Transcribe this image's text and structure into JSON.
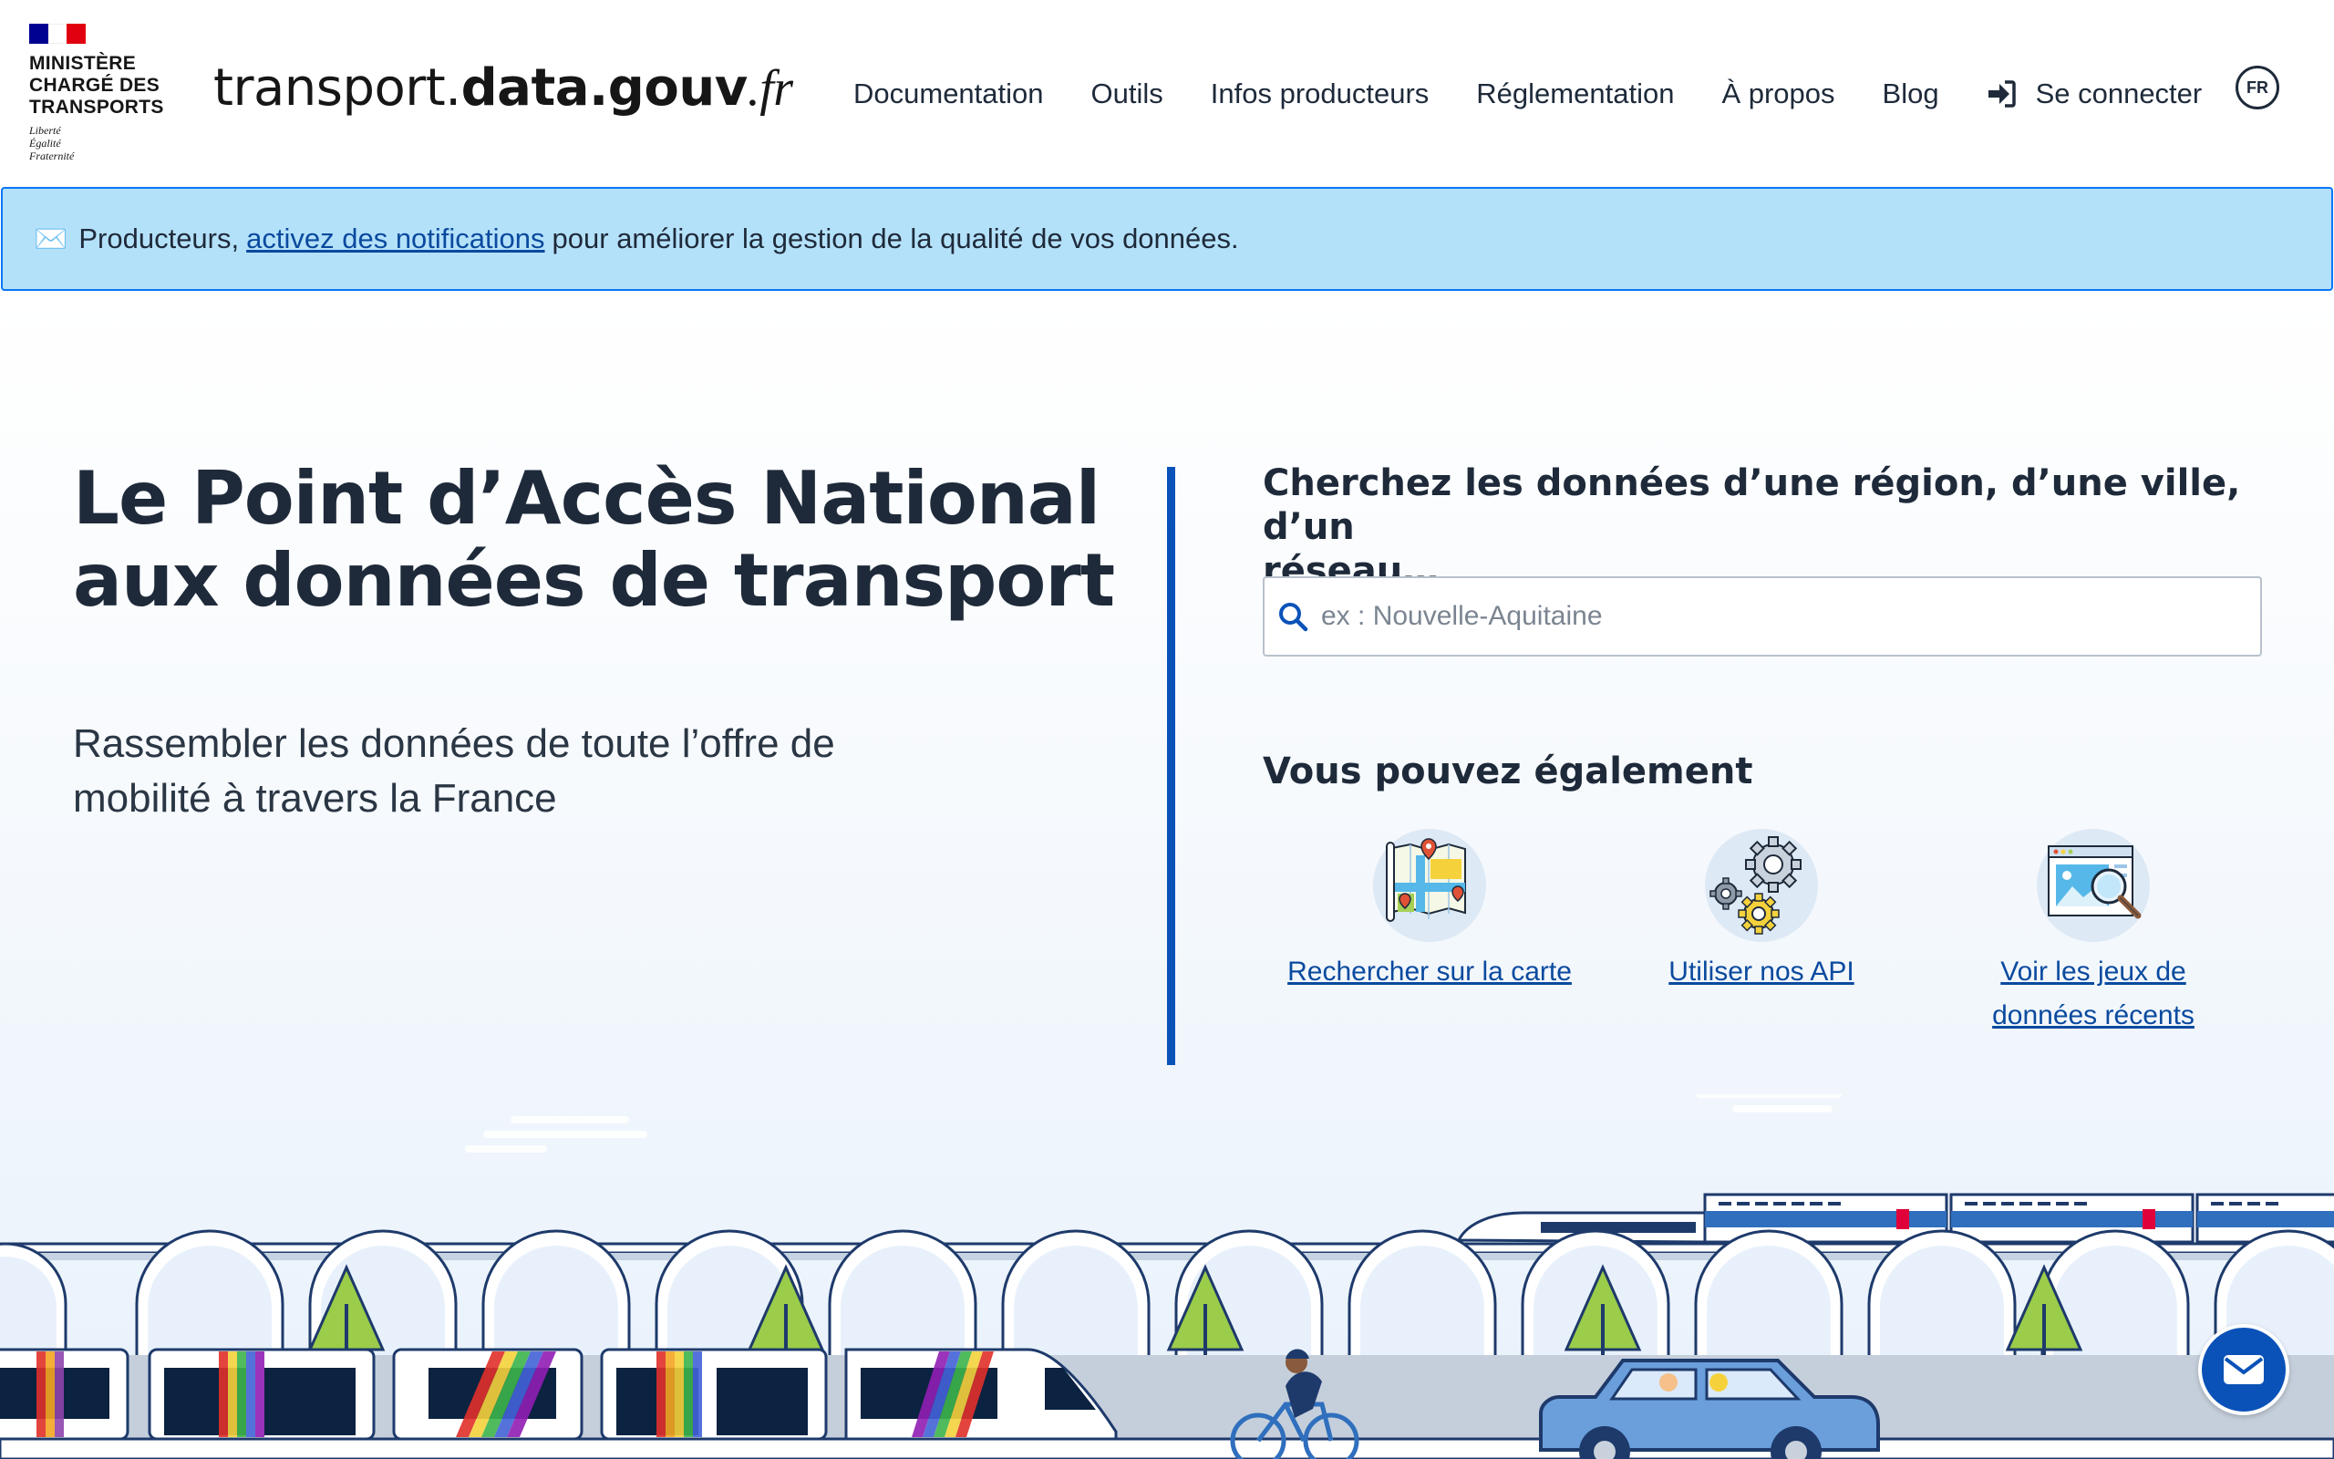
{
  "header": {
    "ministry": [
      "MINISTÈRE",
      "CHARGÉ DES",
      "TRANSPORTS"
    ],
    "motto": [
      "Liberté",
      "Égalité",
      "Fraternité"
    ],
    "site_title": {
      "part1": "transport.",
      "part2": "data.gouv",
      "part3": ".fr"
    },
    "nav": {
      "documentation": "Documentation",
      "outils": "Outils",
      "infos_producteurs": "Infos producteurs",
      "reglementation": "Réglementation",
      "a_propos": "À propos",
      "blog": "Blog",
      "login": "Se connecter"
    },
    "lang": "FR"
  },
  "banner": {
    "icon": "envelope-icon",
    "prefix": "Producteurs,",
    "link": "activez des notifications",
    "suffix": "pour améliorer la gestion de la qualité de vos données."
  },
  "hero": {
    "title_line1": "Le Point d’Accès National",
    "title_line2": "aux données de transport",
    "subtitle_line1": "Rassembler les données de toute l’offre de",
    "subtitle_line2": "mobilité à travers la France"
  },
  "search": {
    "heading_line1": "Cherchez les données d’une région, d’une ville, d’un",
    "heading_line2": "réseau…",
    "placeholder": "ex : Nouvelle-Aquitaine"
  },
  "also": {
    "heading": "Vous pouvez également",
    "actions": [
      {
        "label": "Rechercher sur la carte",
        "icon": "map-icon"
      },
      {
        "label": "Utiliser nos API",
        "icon": "gears-icon"
      },
      {
        "label_line1": "Voir les jeux de",
        "label_line2": "données récents",
        "icon": "dataset-search-icon"
      }
    ]
  },
  "colors": {
    "accent": "#0a52b8",
    "banner_bg": "#b4e1fa",
    "text": "#1e2a3a",
    "link": "#0a4a9e"
  }
}
